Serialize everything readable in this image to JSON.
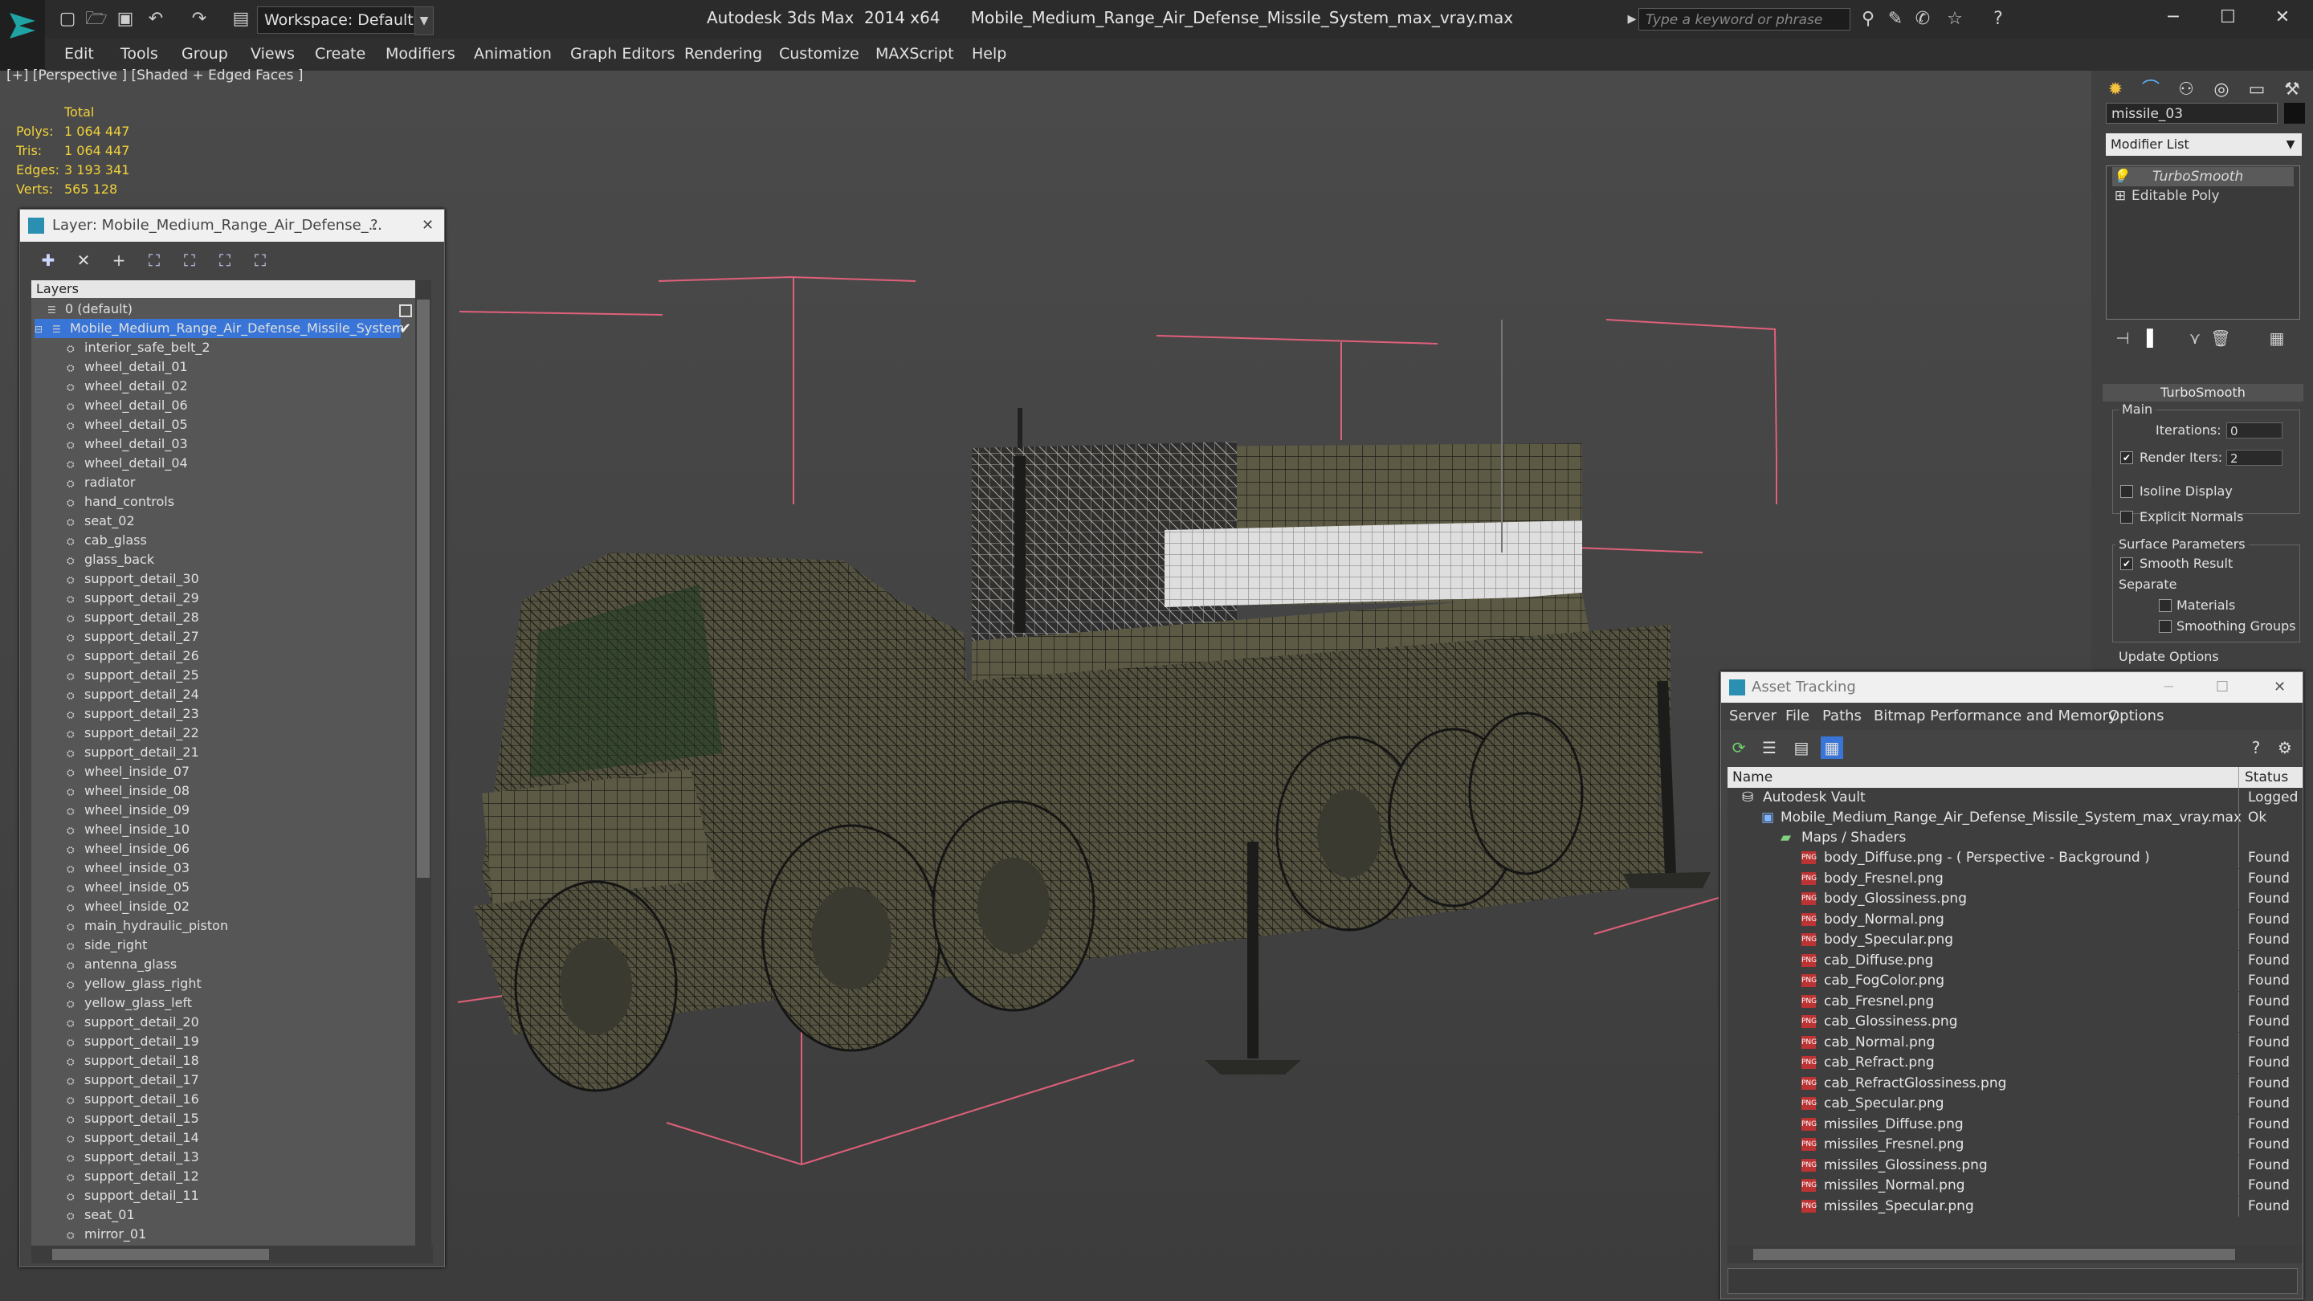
{
  "titlebar": {
    "workspace": "Workspace: Default",
    "title": "Autodesk 3ds Max  2014 x64      Mobile_Medium_Range_Air_Defense_Missile_System_max_vray.max",
    "search_placeholder": "Type a keyword or phrase"
  },
  "menu": [
    "Edit",
    "Tools",
    "Group",
    "Views",
    "Create",
    "Modifiers",
    "Animation",
    "Graph Editors",
    "Rendering",
    "Customize",
    "MAXScript",
    "Help"
  ],
  "viewport": {
    "label": "[+] [Perspective ] [Shaded + Edged Faces ]",
    "stats": {
      "header": "Total",
      "polys_label": "Polys:",
      "polys": "1 064 447",
      "tris_label": "Tris:",
      "tris": "1 064 447",
      "edges_label": "Edges:",
      "edges": "3 193 341",
      "verts_label": "Verts:",
      "verts": "565 128"
    }
  },
  "layer_dialog": {
    "title": "Layer: Mobile_Medium_Range_Air_Defense_...",
    "help": "?",
    "close": "✕",
    "column": "Layers",
    "layers": [
      "0 (default)",
      "Mobile_Medium_Range_Air_Defense_Missile_System"
    ],
    "objects": [
      "interior_safe_belt_2",
      "wheel_detail_01",
      "wheel_detail_02",
      "wheel_detail_06",
      "wheel_detail_05",
      "wheel_detail_03",
      "wheel_detail_04",
      "radiator",
      "hand_controls",
      "seat_02",
      "cab_glass",
      "glass_back",
      "support_detail_30",
      "support_detail_29",
      "support_detail_28",
      "support_detail_27",
      "support_detail_26",
      "support_detail_25",
      "support_detail_24",
      "support_detail_23",
      "support_detail_22",
      "support_detail_21",
      "wheel_inside_07",
      "wheel_inside_08",
      "wheel_inside_09",
      "wheel_inside_10",
      "wheel_inside_06",
      "wheel_inside_03",
      "wheel_inside_05",
      "wheel_inside_02",
      "main_hydraulic_piston",
      "side_right",
      "antenna_glass",
      "yellow_glass_right",
      "yellow_glass_left",
      "support_detail_20",
      "support_detail_19",
      "support_detail_18",
      "support_detail_17",
      "support_detail_16",
      "support_detail_15",
      "support_detail_14",
      "support_detail_13",
      "support_detail_12",
      "support_detail_11",
      "seat_01",
      "mirror_01"
    ]
  },
  "command_panel": {
    "object_name": "missile_03",
    "modifier_list": "Modifier List",
    "stack": [
      "TurboSmooth",
      "Editable Poly"
    ],
    "rollout": "TurboSmooth",
    "main": "Main",
    "iterations_label": "Iterations:",
    "iterations": "0",
    "render_iters_label": "Render Iters:",
    "render_iters": "2",
    "isoline": "Isoline Display",
    "explicit": "Explicit Normals",
    "surface": "Surface Parameters",
    "smooth_result": "Smooth Result",
    "separate": "Separate",
    "materials": "Materials",
    "smoothing_groups": "Smoothing Groups",
    "update": "Update Options"
  },
  "asset_tracking": {
    "title": "Asset Tracking",
    "menu": [
      "Server",
      "File",
      "Paths",
      "Bitmap Performance and Memory",
      "Options"
    ],
    "col_name": "Name",
    "col_status": "Status",
    "vault": "Autodesk Vault",
    "vault_status": "Logged O",
    "file": "Mobile_Medium_Range_Air_Defense_Missile_System_max_vray.max",
    "file_status": "Ok",
    "maps": "Maps / Shaders",
    "textures": [
      {
        "name": "body_Diffuse.png  -  ( Perspective - Background )",
        "status": "Found"
      },
      {
        "name": "body_Fresnel.png",
        "status": "Found"
      },
      {
        "name": "body_Glossiness.png",
        "status": "Found"
      },
      {
        "name": "body_Normal.png",
        "status": "Found"
      },
      {
        "name": "body_Specular.png",
        "status": "Found"
      },
      {
        "name": "cab_Diffuse.png",
        "status": "Found"
      },
      {
        "name": "cab_FogColor.png",
        "status": "Found"
      },
      {
        "name": "cab_Fresnel.png",
        "status": "Found"
      },
      {
        "name": "cab_Glossiness.png",
        "status": "Found"
      },
      {
        "name": "cab_Normal.png",
        "status": "Found"
      },
      {
        "name": "cab_Refract.png",
        "status": "Found"
      },
      {
        "name": "cab_RefractGlossiness.png",
        "status": "Found"
      },
      {
        "name": "cab_Specular.png",
        "status": "Found"
      },
      {
        "name": "missiles_Diffuse.png",
        "status": "Found"
      },
      {
        "name": "missiles_Fresnel.png",
        "status": "Found"
      },
      {
        "name": "missiles_Glossiness.png",
        "status": "Found"
      },
      {
        "name": "missiles_Normal.png",
        "status": "Found"
      },
      {
        "name": "missiles_Specular.png",
        "status": "Found"
      }
    ]
  },
  "colors": {
    "stat_text": "#f2d23a",
    "selection": "#3875d7",
    "wire": "#1a1a1a",
    "helper_lines": "#e0607a"
  }
}
